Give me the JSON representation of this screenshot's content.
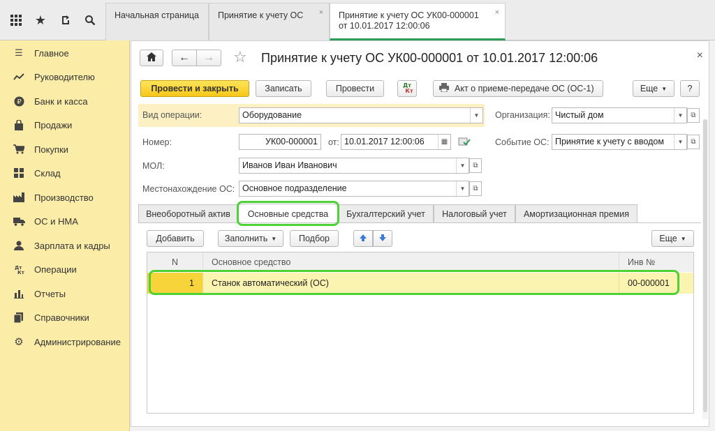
{
  "topbar": {
    "tabs": [
      {
        "label": "Начальная страница"
      },
      {
        "label": "Принятие к учету ОС",
        "close": "×"
      },
      {
        "label_line1": "Принятие к учету ОС УК00-000001",
        "label_line2": "от 10.01.2017 12:00:06",
        "close": "×"
      }
    ]
  },
  "sidebar": {
    "items": [
      {
        "label": "Главное"
      },
      {
        "label": "Руководителю"
      },
      {
        "label": "Банк и касса"
      },
      {
        "label": "Продажи"
      },
      {
        "label": "Покупки"
      },
      {
        "label": "Склад"
      },
      {
        "label": "Производство"
      },
      {
        "label": "ОС и НМА"
      },
      {
        "label": "Зарплата и кадры"
      },
      {
        "label": "Операции"
      },
      {
        "label": "Отчеты"
      },
      {
        "label": "Справочники"
      },
      {
        "label": "Администрирование"
      }
    ]
  },
  "document": {
    "title": "Принятие к учету ОС УК00-000001 от 10.01.2017 12:00:06",
    "close": "×",
    "toolbar": {
      "post_close": "Провести и закрыть",
      "save": "Записать",
      "post": "Провести",
      "dt_kt_top": "Дт",
      "dt_kt_bottom": "Кт",
      "act": "Акт о приеме-передаче ОС (ОС-1)",
      "more": "Еще",
      "help": "?"
    },
    "fields": {
      "operation_label": "Вид операции:",
      "operation_value": "Оборудование",
      "org_label": "Организация:",
      "org_value": "Чистый дом",
      "number_label": "Номер:",
      "number_value": "УК00-000001",
      "date_label": "от:",
      "date_value": "10.01.2017 12:00:06",
      "event_label": "Событие ОС:",
      "event_value": "Принятие к учету с вводом",
      "mol_label": "МОЛ:",
      "mol_value": "Иванов Иван Иванович",
      "location_label": "Местонахождение ОС:",
      "location_value": "Основное подразделение"
    },
    "tabs": [
      {
        "label": "Внеоборотный актив"
      },
      {
        "label": "Основные средства"
      },
      {
        "label": "Бухгалтерский учет"
      },
      {
        "label": "Налоговый учет"
      },
      {
        "label": "Амортизационная премия"
      }
    ],
    "table_toolbar": {
      "add": "Добавить",
      "fill": "Заполнить",
      "select": "Подбор",
      "more": "Еще"
    },
    "table": {
      "columns": [
        "N",
        "Основное средство",
        "Инв №"
      ],
      "rows": [
        {
          "n": "1",
          "asset": "Станок автоматический (ОС)",
          "inv": "00-000001"
        }
      ]
    }
  },
  "colors": {
    "sidebar_bg": "#fbeca7",
    "primary_button": "#f6c71b",
    "highlight_outline": "#4cd137",
    "active_tab_underline": "#2f9d57",
    "selected_row": "#fbf4b0"
  }
}
